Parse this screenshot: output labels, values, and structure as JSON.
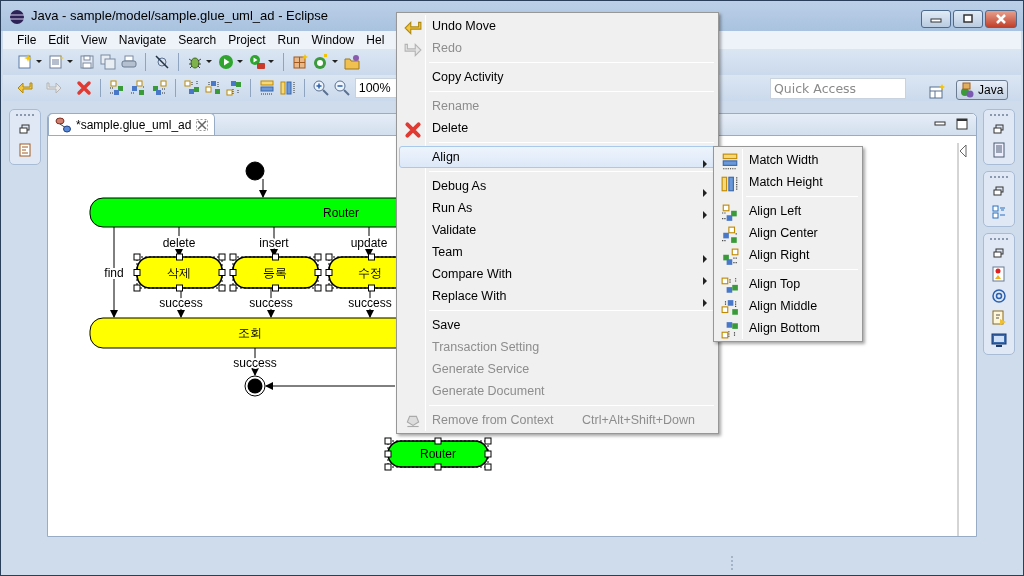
{
  "window": {
    "title": "Java - sample/model/sample.glue_uml_ad - Eclipse"
  },
  "menu_bar": [
    "File",
    "Edit",
    "View",
    "Navigate",
    "Search",
    "Project",
    "Run",
    "Window",
    "Hel"
  ],
  "zoom_field": {
    "value": "100%"
  },
  "quick_access": {
    "placeholder": "Quick Access"
  },
  "perspective": {
    "label": "Java",
    "selected": true
  },
  "editor_tab": {
    "title": "*sample.glue_uml_ad"
  },
  "diagram": {
    "nodes": [
      {
        "kind": "start",
        "selected": false
      },
      {
        "kind": "bar",
        "label": "Router",
        "color": "#00ff00",
        "selected": false
      },
      {
        "kind": "action",
        "label": "삭제",
        "color": "#ffff00",
        "selected": true
      },
      {
        "kind": "action",
        "label": "등록",
        "color": "#ffff00",
        "selected": true
      },
      {
        "kind": "action",
        "label": "수정",
        "color": "#ffff00",
        "selected": true
      },
      {
        "kind": "bar",
        "label": "조회",
        "color": "#ffff00",
        "selected": false
      },
      {
        "kind": "end",
        "selected": false
      },
      {
        "kind": "action",
        "label": "Router",
        "color": "#00ff00",
        "selected": true
      }
    ],
    "edge_labels": [
      "delete",
      "insert",
      "update",
      "find",
      "success",
      "success",
      "success",
      "success"
    ]
  },
  "context_menu": {
    "groups": [
      [
        {
          "label": "Undo Move",
          "disabled": false,
          "submenu": false,
          "selected": false
        },
        {
          "label": "Redo",
          "disabled": true,
          "submenu": false,
          "selected": false
        }
      ],
      [
        {
          "label": "Copy Activity",
          "disabled": false,
          "submenu": false,
          "selected": false
        }
      ],
      [
        {
          "label": "Rename",
          "disabled": true,
          "submenu": false,
          "selected": false
        },
        {
          "label": "Delete",
          "disabled": false,
          "submenu": false,
          "selected": false
        }
      ],
      [
        {
          "label": "Align",
          "disabled": false,
          "submenu": true,
          "selected": true
        }
      ],
      [
        {
          "label": "Debug As",
          "disabled": false,
          "submenu": true,
          "selected": false
        },
        {
          "label": "Run As",
          "disabled": false,
          "submenu": true,
          "selected": false
        },
        {
          "label": "Validate",
          "disabled": false,
          "submenu": false,
          "selected": false
        },
        {
          "label": "Team",
          "disabled": false,
          "submenu": true,
          "selected": false
        },
        {
          "label": "Compare With",
          "disabled": false,
          "submenu": true,
          "selected": false
        },
        {
          "label": "Replace With",
          "disabled": false,
          "submenu": true,
          "selected": false
        }
      ],
      [
        {
          "label": "Save",
          "disabled": false,
          "submenu": false,
          "selected": false
        },
        {
          "label": "Transaction Setting",
          "disabled": true,
          "submenu": false,
          "selected": false
        },
        {
          "label": "Generate Service",
          "disabled": true,
          "submenu": false,
          "selected": false
        },
        {
          "label": "Generate Document",
          "disabled": true,
          "submenu": false,
          "selected": false
        }
      ],
      [
        {
          "label": "Remove from Context",
          "shortcut": "Ctrl+Alt+Shift+Down",
          "disabled": true,
          "submenu": false,
          "selected": false
        }
      ]
    ]
  },
  "align_submenu": {
    "groups": [
      [
        {
          "label": "Match Width",
          "selected": false
        },
        {
          "label": "Match Height",
          "selected": false
        }
      ],
      [
        {
          "label": "Align Left",
          "selected": false
        },
        {
          "label": "Align Center",
          "selected": false
        },
        {
          "label": "Align Right",
          "selected": false
        }
      ],
      [
        {
          "label": "Align Top",
          "selected": false
        },
        {
          "label": "Align Middle",
          "selected": false
        },
        {
          "label": "Align Bottom",
          "selected": false
        }
      ]
    ]
  }
}
